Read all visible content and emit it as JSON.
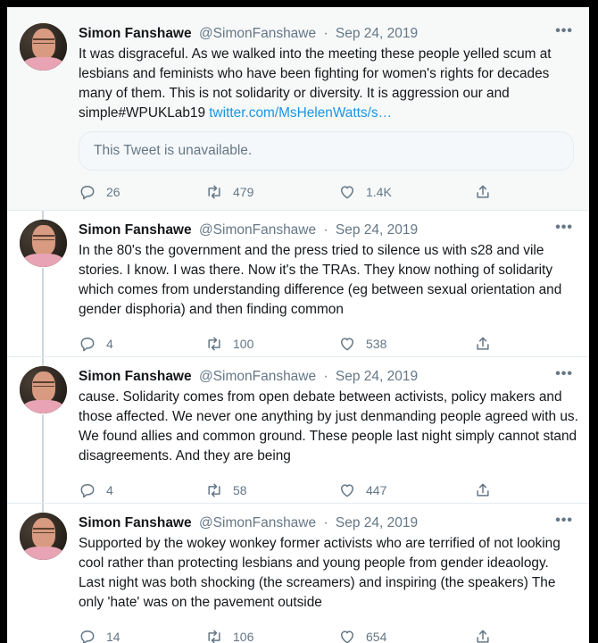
{
  "tweets": [
    {
      "name": "Simon Fanshawe",
      "handle": "@SimonFanshawe",
      "separator": "·",
      "date": "Sep 24, 2019",
      "text": "It was disgraceful. As we walked into the meeting these people yelled scum at lesbians and feminists who have been fighting for women's rights for decades many of them. This is not solidarity or diversity. It is aggression our and simple#WPUKLab19 ",
      "link": "twitter.com/MsHelenWatts/s…",
      "quote": "This Tweet is unavailable.",
      "replies": "26",
      "retweets": "479",
      "likes": "1.4K"
    },
    {
      "name": "Simon Fanshawe",
      "handle": "@SimonFanshawe",
      "separator": "·",
      "date": "Sep 24, 2019",
      "text": "In the 80's the government and the press tried to silence us with s28 and vile stories. I know. I was there. Now it's the TRAs. They know nothing of solidarity which comes from understanding difference (eg between sexual orientation and gender disphoria) and then finding common",
      "replies": "4",
      "retweets": "100",
      "likes": "538"
    },
    {
      "name": "Simon Fanshawe",
      "handle": "@SimonFanshawe",
      "separator": "·",
      "date": "Sep 24, 2019",
      "text": "cause. Solidarity comes from open debate between activists, policy makers and those affected. We never one anything by just denmanding people agreed with us. We found allies and common ground. These people last night simply cannot stand disagreements. And they are being",
      "replies": "4",
      "retweets": "58",
      "likes": "447"
    },
    {
      "name": "Simon Fanshawe",
      "handle": "@SimonFanshawe",
      "separator": "·",
      "date": "Sep 24, 2019",
      "text": "Supported by the wokey wonkey former activists who are terrified of not looking cool rather than protecting lesbians and young people from gender ideaology. Last night was both shocking (the screamers) and inspiring (the speakers) The only 'hate' was on the pavement outside",
      "replies": "14",
      "retweets": "106",
      "likes": "654"
    }
  ],
  "more_label": "•••",
  "icons": {
    "reply": "reply-icon",
    "retweet": "retweet-icon",
    "like": "heart-icon",
    "share": "share-icon"
  },
  "colors": {
    "link": "#1b95e0",
    "muted": "#657786",
    "text": "#14171a",
    "thread_line": "#ccd6dd"
  }
}
